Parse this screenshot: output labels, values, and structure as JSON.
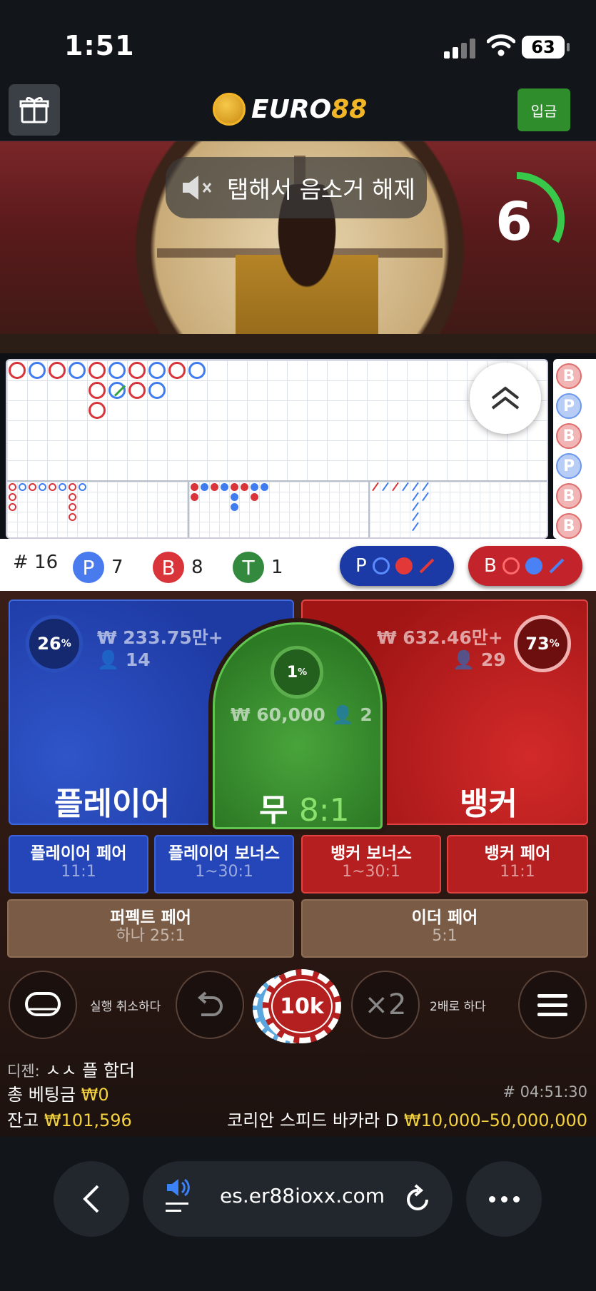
{
  "status_bar": {
    "time": "1:51",
    "battery": "63"
  },
  "header": {
    "logo_part1": "EURO",
    "logo_part2": "88",
    "deposit_label": "입금"
  },
  "video": {
    "mute_text": "탭해서 음소거 해제",
    "countdown": "6",
    "countdown_progress": 0.6
  },
  "roadmap": {
    "side_beads": [
      "B",
      "P",
      "B",
      "P",
      "B",
      "B"
    ],
    "counts": {
      "round": "# 16",
      "player_label": "P",
      "player_count": "7",
      "banker_label": "B",
      "banker_count": "8",
      "tie_label": "T",
      "tie_count": "1"
    },
    "predict_player": "P",
    "predict_banker": "B"
  },
  "bets": {
    "player": {
      "label": "플레이어",
      "percent": "26",
      "amount": "₩ 233.75만+",
      "users": "14"
    },
    "banker": {
      "label": "뱅커",
      "percent": "73",
      "amount": "₩ 632.46만+",
      "users": "29"
    },
    "tie": {
      "label": "무",
      "odds": "8:1",
      "percent": "1",
      "amount": "₩ 60,000",
      "users": "2"
    },
    "percent_sign": "%",
    "side_bets": [
      {
        "label": "플레이어 페어",
        "odds": "11:1"
      },
      {
        "label": "플레이어 보너스",
        "odds": "1~30:1"
      },
      {
        "label": "뱅커 보너스",
        "odds": "1~30:1"
      },
      {
        "label": "뱅커 페어",
        "odds": "11:1"
      },
      {
        "label": "퍼펙트 페어",
        "odds": "하나 25:1"
      },
      {
        "label": "이더 페어",
        "odds": "5:1"
      }
    ]
  },
  "controls": {
    "undo_label": "실행 취소하다",
    "chip_value": "10k",
    "double_symbol": "×2",
    "double_label": "2배로 하다"
  },
  "info": {
    "dealer_label": "디젠:",
    "dealer_name": "ㅅㅅ 플 함더",
    "total_bet_label": "총 베팅금",
    "total_bet_value": "₩0",
    "round_id": "# 04:51:30",
    "balance_label": "잔고",
    "balance_value": "₩101,596",
    "table_name": "코리안 스피드 바카라 D",
    "limits": "₩10,000–50,000,000"
  },
  "browser": {
    "url": "es.er88ioxx.com"
  },
  "colors": {
    "player": "#2e5bd6",
    "banker": "#d22b2b",
    "tie": "#3a9a33",
    "gold": "#f3d23e",
    "deposit": "#2f8d2c"
  }
}
